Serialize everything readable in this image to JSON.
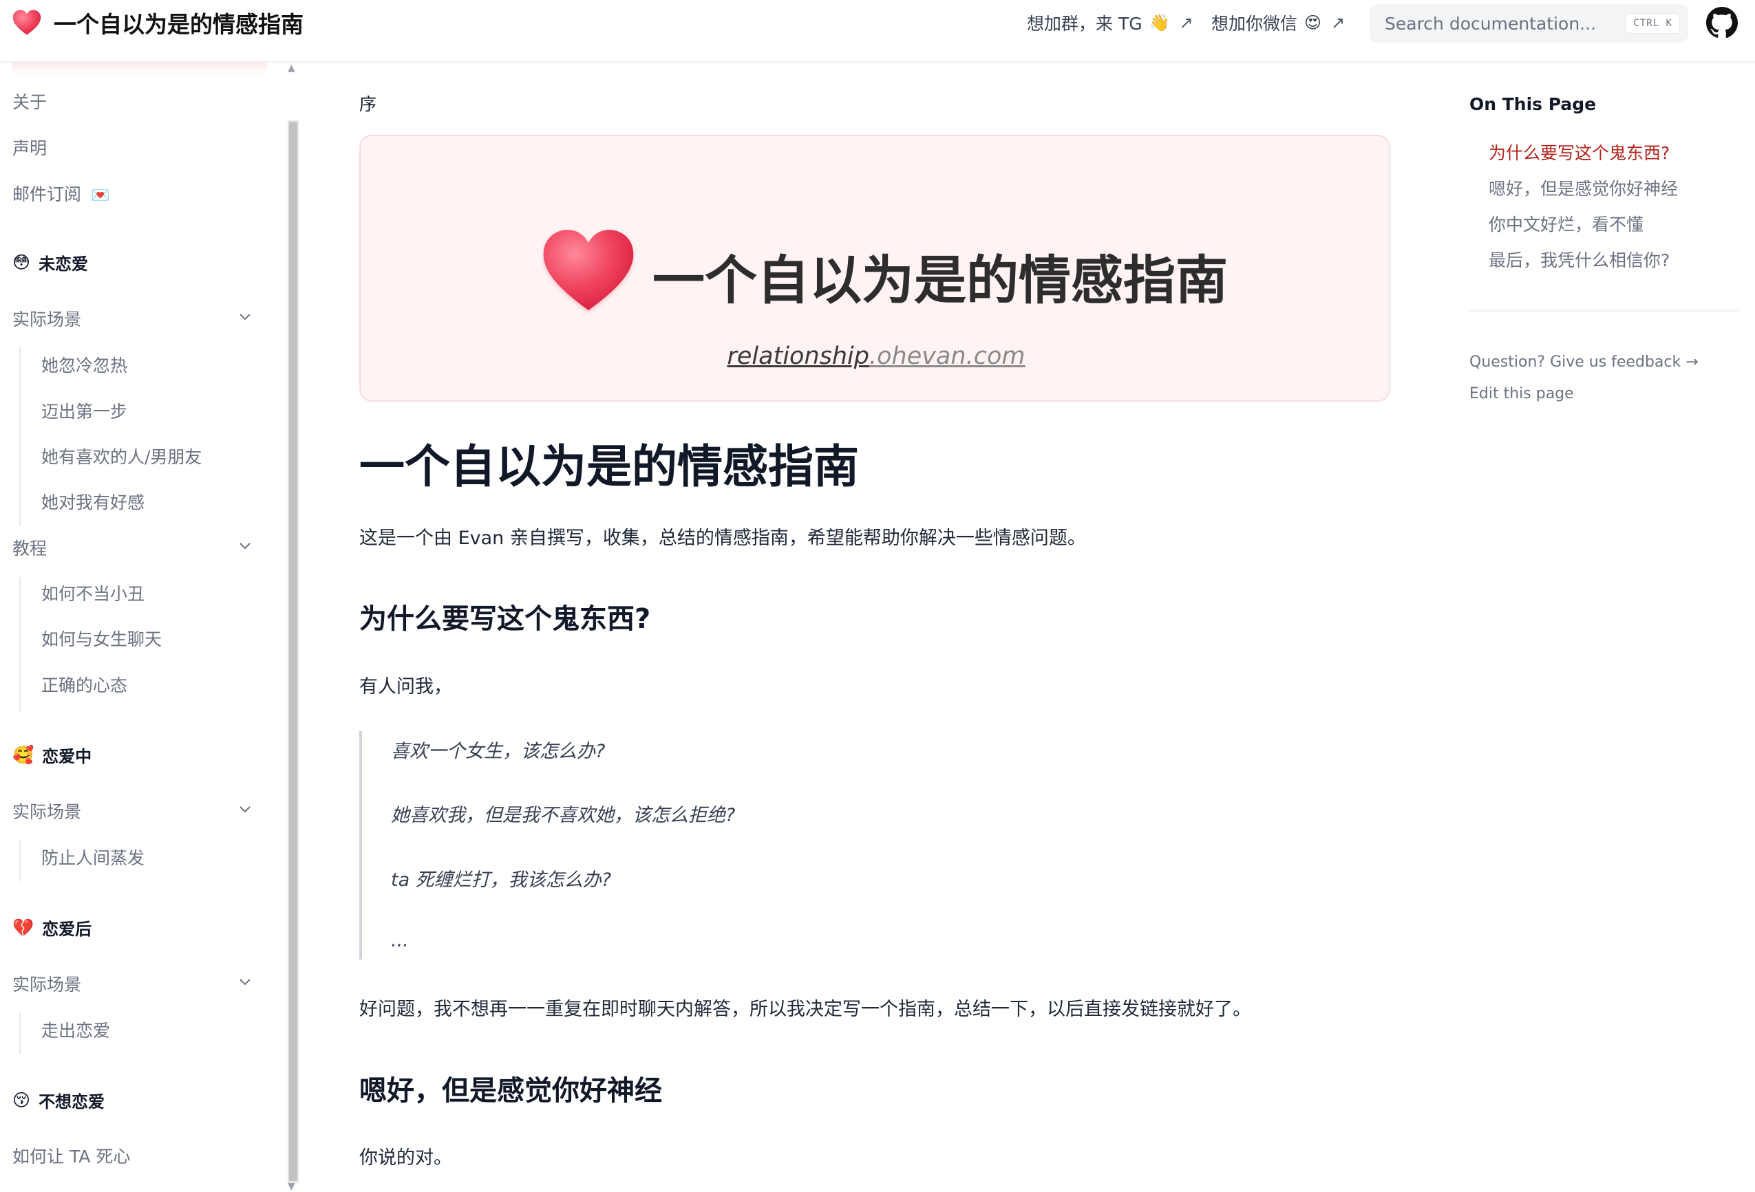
{
  "navbar": {
    "brand_title": "一个自以为是的情感指南",
    "links": [
      {
        "label": "想加群，来 TG",
        "emoji": "👋",
        "arrow": "↗"
      },
      {
        "label": "想加你微信",
        "emoji": "😍",
        "arrow": "↗"
      }
    ],
    "search": {
      "placeholder": "Search documentation...",
      "shortcut": "CTRL K"
    }
  },
  "sidebar": {
    "top_items": [
      "关于",
      "声明",
      "邮件订阅"
    ],
    "subscribe_emoji": "💌",
    "sections": [
      {
        "title": "未恋爱",
        "emoji": "😳",
        "groups": [
          {
            "label": "实际场景",
            "items": [
              "她忽冷忽热",
              "迈出第一步",
              "她有喜欢的人/男朋友",
              "她对我有好感"
            ]
          },
          {
            "label": "教程",
            "items": [
              "如何不当小丑",
              "如何与女生聊天",
              "正确的心态"
            ]
          }
        ]
      },
      {
        "title": "恋爱中",
        "emoji": "🥰",
        "groups": [
          {
            "label": "实际场景",
            "items": [
              "防止人间蒸发"
            ]
          }
        ]
      },
      {
        "title": "恋爱后",
        "emoji": "💔",
        "groups": [
          {
            "label": "实际场景",
            "items": [
              "走出恋爱"
            ]
          }
        ]
      },
      {
        "title": "不想恋爱",
        "emoji": "😚",
        "items": [
          "如何让 TA 死心"
        ]
      }
    ]
  },
  "main": {
    "breadcrumb": "序",
    "banner": {
      "title": "一个自以为是的情感指南",
      "url_main": "relationship",
      "url_domain": ".ohevan.com"
    },
    "title": "一个自以为是的情感指南",
    "intro": "这是一个由 Evan 亲自撰写，收集，总结的情感指南，希望能帮助你解决一些情感问题。",
    "section1": {
      "heading": "为什么要写这个鬼东西?",
      "lead": "有人问我，",
      "quotes": [
        "喜欢一个女生，该怎么办?",
        "她喜欢我，但是我不喜欢她，该怎么拒绝?",
        "ta 死缠烂打，我该怎么办?",
        "..."
      ],
      "after": "好问题，我不想再一一重复在即时聊天内解答，所以我决定写一个指南，总结一下，以后直接发链接就好了。"
    },
    "section2": {
      "heading": "嗯好，但是感觉你好神经",
      "text": "你说的对。"
    }
  },
  "toc": {
    "title": "On This Page",
    "items": [
      "为什么要写这个鬼东西?",
      "嗯好，但是感觉你好神经",
      "你中文好烂，看不懂",
      "最后，我凭什么相信你?"
    ],
    "active_index": 0,
    "feedback": "Question? Give us feedback →",
    "edit": "Edit this page"
  },
  "colors": {
    "accent": "#b3261e",
    "banner_bg": "#fff3f3",
    "heart": "#f0445e"
  }
}
